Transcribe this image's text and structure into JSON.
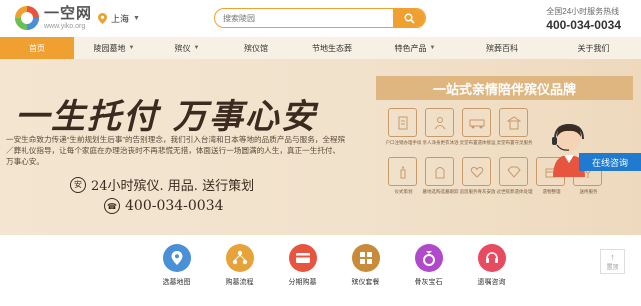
{
  "header": {
    "logo_title": "一空网",
    "logo_url": "www.yiko.org",
    "location": "上海",
    "search_placeholder": "搜索陵园",
    "hotline_label": "全国24小时服务热线",
    "hotline_number": "400-034-0034"
  },
  "nav": {
    "items": [
      {
        "label": "首页",
        "active": true,
        "dropdown": false
      },
      {
        "label": "陵园墓地",
        "active": false,
        "dropdown": true
      },
      {
        "label": "殡仪",
        "active": false,
        "dropdown": true
      },
      {
        "label": "殡仪馆",
        "active": false,
        "dropdown": false
      },
      {
        "label": "节地生态葬",
        "active": false,
        "dropdown": false
      },
      {
        "label": "特色产品",
        "active": false,
        "dropdown": true
      },
      {
        "label": "殡葬百科",
        "active": false,
        "dropdown": false
      },
      {
        "label": "关于我们",
        "active": false,
        "dropdown": false
      }
    ]
  },
  "banner": {
    "slogan": "一生托付 万事心安",
    "intro": "一安生命致力传递“生前规划生后事”的告别理念，我们引入台湾和日本等地的品质产品与服务，全程殡／葬礼仪指导，让每个家庭在办理治丧时不再悲慌无措，体面送行一场圆满的人生，真正一生托付、万事心安。",
    "service_line": "24小时殡仪. 用品. 送行策划",
    "phone": "400-034-0034",
    "brand_title": "一站式亲情陪伴殡仪品牌",
    "services": [
      "户口注销办理手续",
      "亲人净身更衣沐浴",
      "灵堂布置遗体接运",
      "灵堂布置守灵服务",
      "",
      "",
      "仪式策划",
      "墓地选购选墓跟踪",
      "追思服务骨灰安放",
      "过世殡葬遗体处理",
      "遗物整理",
      "送终服务"
    ],
    "online_label": "在线咨询",
    "slide_count": 3,
    "active_slide": 2
  },
  "features": [
    {
      "label": "选墓地图",
      "color": "#4a90d9",
      "icon": "map-pin-icon"
    },
    {
      "label": "购墓流程",
      "color": "#e8a23a",
      "icon": "flow-icon"
    },
    {
      "label": "分期购墓",
      "color": "#e8553f",
      "icon": "card-icon"
    },
    {
      "label": "殡仪套餐",
      "color": "#c98a3a",
      "icon": "package-icon"
    },
    {
      "label": "骨灰宝石",
      "color": "#b04acb",
      "icon": "gem-icon"
    },
    {
      "label": "遗嘱咨询",
      "color": "#e84a5f",
      "icon": "headset-icon"
    }
  ],
  "backtop_label": "置顶"
}
